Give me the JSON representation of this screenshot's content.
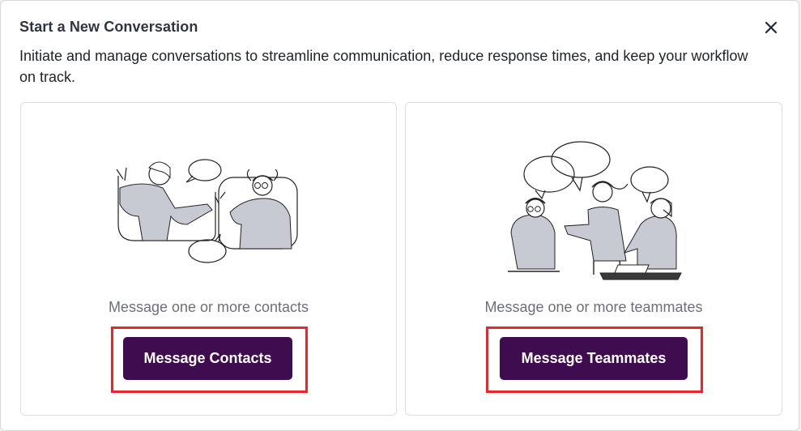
{
  "modal": {
    "title": "Start a New Conversation",
    "description": "Initiate and manage conversations to streamline communication, reduce response times, and keep your workflow on track.",
    "close_icon": "close-icon"
  },
  "options": [
    {
      "caption": "Message one or more contacts",
      "button_label": "Message Contacts",
      "illustration": "two-people-video-chat-illustration"
    },
    {
      "caption": "Message one or more teammates",
      "button_label": "Message Teammates",
      "illustration": "team-discussion-illustration"
    }
  ],
  "colors": {
    "button_bg": "#3f0c50",
    "highlight": "#e8262b",
    "caption": "#6b6f78"
  }
}
